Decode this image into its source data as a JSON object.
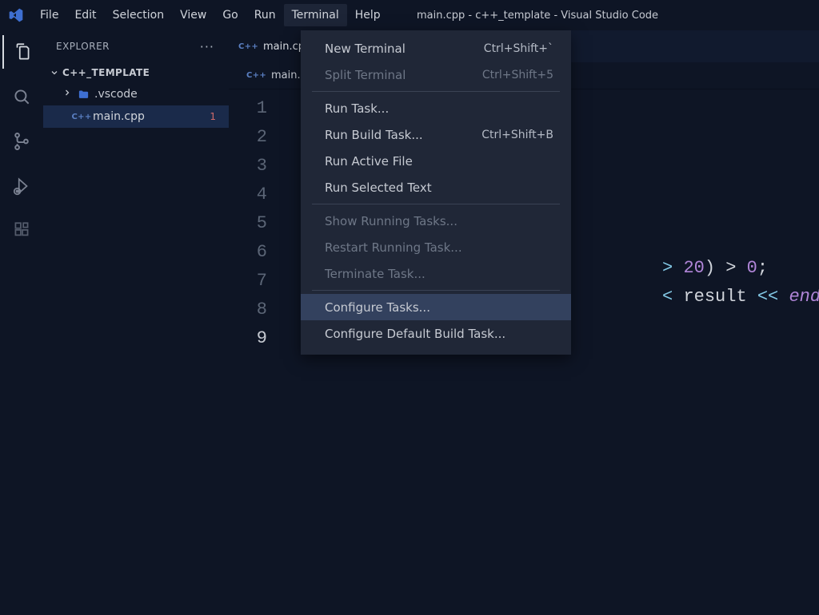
{
  "window_title": "main.cpp - c++_template - Visual Studio Code",
  "menu": {
    "file": "File",
    "edit": "Edit",
    "selection": "Selection",
    "view": "View",
    "go": "Go",
    "run": "Run",
    "terminal": "Terminal",
    "help": "Help"
  },
  "sidebar": {
    "title": "EXPLORER",
    "folder": "C++_TEMPLATE",
    "vscode_folder": ".vscode",
    "file": "main.cpp",
    "file_badge": "1"
  },
  "tabs": {
    "active": "main.cp",
    "crumb": "main.c"
  },
  "cpp_label": "C++",
  "gutter": [
    "1",
    "2",
    "3",
    "4",
    "5",
    "6",
    "7",
    "8",
    "9"
  ],
  "code": {
    "line6_a": "20",
    "line6_b": ") > ",
    "line6_c": "0",
    "line6_d": ";",
    "line6_pre": "> ",
    "line7_a": "< ",
    "line7_b": "result",
    "line7_c": " << ",
    "line7_d": "endl",
    "line7_e": ";"
  },
  "dropdown": {
    "new_terminal": "New Terminal",
    "new_terminal_kbd": "Ctrl+Shift+`",
    "split_terminal": "Split Terminal",
    "split_terminal_kbd": "Ctrl+Shift+5",
    "run_task": "Run Task...",
    "run_build_task": "Run Build Task...",
    "run_build_task_kbd": "Ctrl+Shift+B",
    "run_active_file": "Run Active File",
    "run_selected_text": "Run Selected Text",
    "show_running_tasks": "Show Running Tasks...",
    "restart_running_task": "Restart Running Task...",
    "terminate_task": "Terminate Task...",
    "configure_tasks": "Configure Tasks...",
    "configure_default_build": "Configure Default Build Task..."
  }
}
